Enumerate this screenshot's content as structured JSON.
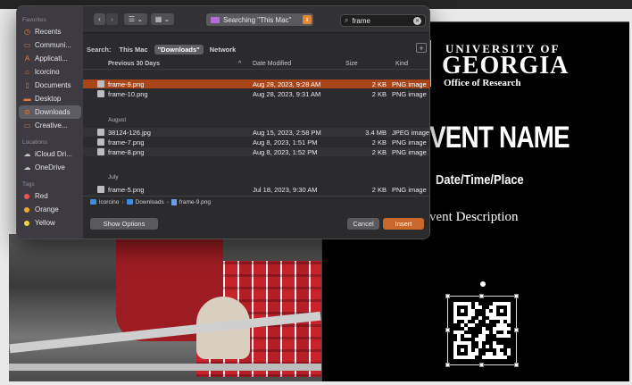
{
  "poster": {
    "univ": "UNIVERSITY OF",
    "georgia": "GEORGIA",
    "office": "Office of Research",
    "event_name": "VENT NAME",
    "datetime": "Date/Time/Place",
    "description": "vent Description"
  },
  "dialog": {
    "toolbar": {
      "back": "‹",
      "forward": "›",
      "view_list": "☰ ⌄",
      "view_grid": "▦ ⌄",
      "location": "Searching \"This Mac\"",
      "search_value": "frame",
      "search_icon": "magnifier-icon",
      "clear_icon": "clear-icon"
    },
    "sidebar": {
      "favorites_label": "Favorites",
      "favorites": [
        {
          "label": "Recents",
          "icon": "clock-icon"
        },
        {
          "label": "Communi...",
          "icon": "folder-icon"
        },
        {
          "label": "Applicati...",
          "icon": "apps-icon"
        },
        {
          "label": "lcorcino",
          "icon": "home-icon"
        },
        {
          "label": "Documents",
          "icon": "doc-icon"
        },
        {
          "label": "Desktop",
          "icon": "desktop-icon"
        },
        {
          "label": "Downloads",
          "icon": "download-icon"
        },
        {
          "label": "Creative...",
          "icon": "folder-icon"
        }
      ],
      "locations_label": "Locations",
      "locations": [
        {
          "label": "iCloud Dri...",
          "icon": "cloud-icon"
        },
        {
          "label": "OneDrive",
          "icon": "cloud-icon"
        }
      ],
      "tags_label": "Tags",
      "tags": [
        {
          "label": "Red",
          "color": "#f05050"
        },
        {
          "label": "Orange",
          "color": "#f5a623"
        },
        {
          "label": "Yellow",
          "color": "#f3d23a"
        }
      ]
    },
    "scope": {
      "label": "Search:",
      "this_mac": "This Mac",
      "downloads": "\"Downloads\"",
      "network": "Network",
      "add": "+"
    },
    "columns": {
      "name": "Previous 30 Days",
      "sort": "^",
      "date": "Date Modified",
      "size": "Size",
      "kind": "Kind"
    },
    "groups": {
      "august": "August",
      "july": "July"
    },
    "files": [
      {
        "name": "frame-9.png",
        "date": "Aug 28, 2023, 9:28 AM",
        "size": "2 KB",
        "kind": "PNG image"
      },
      {
        "name": "frame-10.png",
        "date": "Aug 28, 2023, 9:31 AM",
        "size": "2 KB",
        "kind": "PNG image"
      },
      {
        "name": "38124-126.jpg",
        "date": "Aug 15, 2023, 2:58 PM",
        "size": "3.4 MB",
        "kind": "JPEG image"
      },
      {
        "name": "frame-7.png",
        "date": "Aug 8, 2023, 1:51 PM",
        "size": "2 KB",
        "kind": "PNG image"
      },
      {
        "name": "frame-8.png",
        "date": "Aug 8, 2023, 1:52 PM",
        "size": "2 KB",
        "kind": "PNG image"
      },
      {
        "name": "frame-5.png",
        "date": "Jul 18, 2023, 9:30 AM",
        "size": "2 KB",
        "kind": "PNG image"
      }
    ],
    "pathbar": {
      "p1": "lcorcino",
      "p2": "Downloads",
      "p3": "frame-9.png",
      "sep": "›"
    },
    "buttons": {
      "show_options": "Show Options",
      "cancel": "Cancel",
      "insert": "Insert"
    }
  }
}
